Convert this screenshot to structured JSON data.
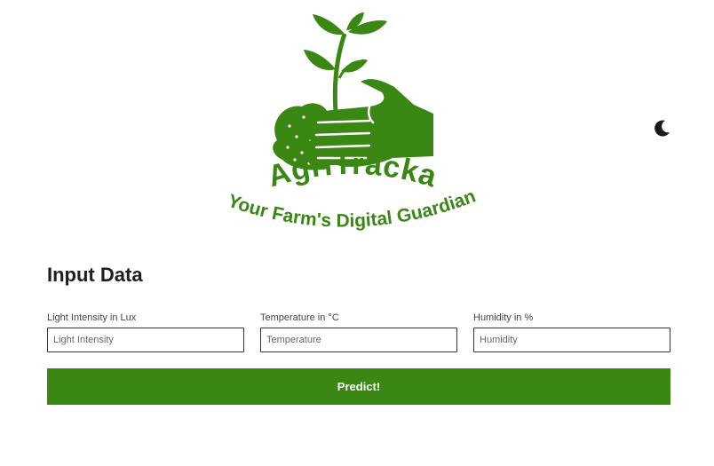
{
  "brand": {
    "name": "AgriTracka",
    "tagline": "Your Farm's Digital Guardian",
    "color": "#3a8714"
  },
  "theme_toggle": {
    "icon": "moon-icon"
  },
  "form": {
    "title": "Input Data",
    "fields": [
      {
        "label": "Light Intensity in Lux",
        "placeholder": "Light Intensity",
        "value": ""
      },
      {
        "label": "Temperature in °C",
        "placeholder": "Temperature",
        "value": ""
      },
      {
        "label": "Humidity in %",
        "placeholder": "Humidity",
        "value": ""
      }
    ],
    "submit_label": "Predict!"
  }
}
